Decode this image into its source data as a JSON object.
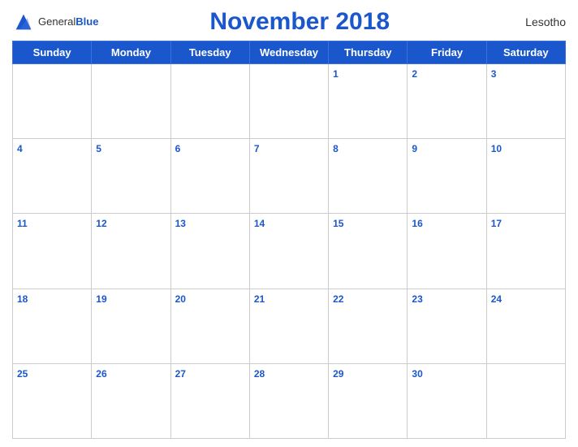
{
  "header": {
    "logo_general": "General",
    "logo_blue": "Blue",
    "title": "November 2018",
    "country": "Lesotho"
  },
  "weekdays": [
    "Sunday",
    "Monday",
    "Tuesday",
    "Wednesday",
    "Thursday",
    "Friday",
    "Saturday"
  ],
  "weeks": [
    [
      null,
      null,
      null,
      null,
      1,
      2,
      3
    ],
    [
      4,
      5,
      6,
      7,
      8,
      9,
      10
    ],
    [
      11,
      12,
      13,
      14,
      15,
      16,
      17
    ],
    [
      18,
      19,
      20,
      21,
      22,
      23,
      24
    ],
    [
      25,
      26,
      27,
      28,
      29,
      30,
      null
    ]
  ]
}
